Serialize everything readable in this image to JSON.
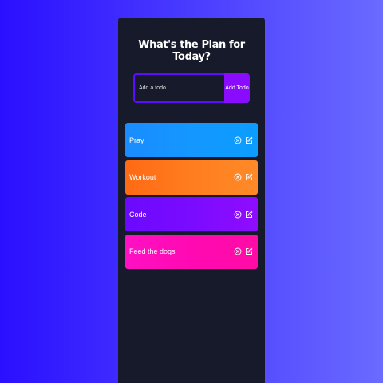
{
  "app": {
    "title": "What's the Plan for Today?"
  },
  "form": {
    "placeholder": "Add a todo",
    "button_label": "Add Todo"
  },
  "todos": [
    {
      "text": "Pray"
    },
    {
      "text": "Workout"
    },
    {
      "text": "Code"
    },
    {
      "text": "Feed the dogs"
    }
  ],
  "icons": {
    "delete": "close-circle-icon",
    "edit": "edit-icon"
  },
  "colors": {
    "background_left": "#2a0fff",
    "background_right": "#6a6bff",
    "panel": "#161a2b",
    "input_border": "#5d0cff",
    "button": "#8a0cff",
    "todo_blue": "#1497ff",
    "todo_orange": "#ff7d1f",
    "todo_purple": "#7a0bff",
    "todo_pink": "#ff0ab2"
  }
}
